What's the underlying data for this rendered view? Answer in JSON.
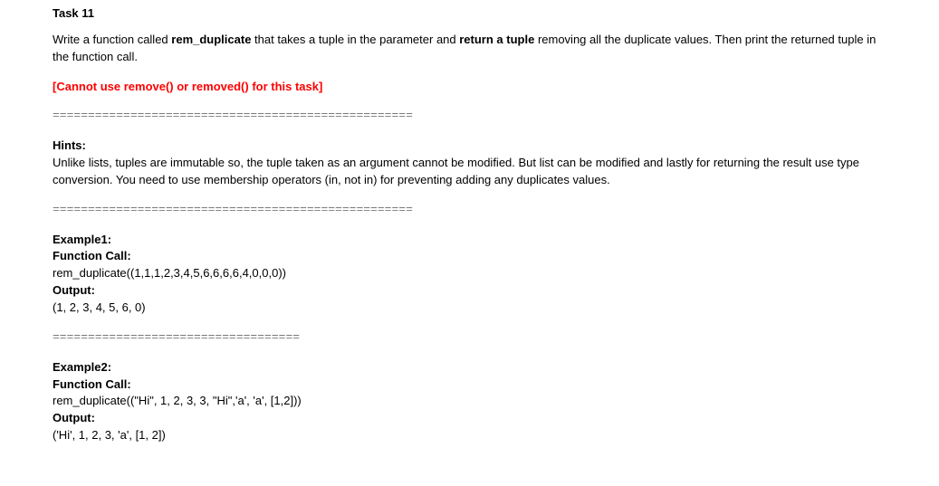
{
  "task": {
    "title": "Task 11",
    "intro_prefix": "Write a function called ",
    "func_name": "rem_duplicate",
    "intro_mid": " that takes a tuple in the parameter and ",
    "return_bold": "return a tuple",
    "intro_suffix": " removing all the duplicate values. Then print the returned tuple in the function call.",
    "restriction": "[Cannot use remove() or removed() for this task]",
    "divider_long": "===================================================",
    "hints_label": "Hints:",
    "hints_text": "Unlike lists, tuples are immutable so, the tuple taken as an argument cannot be modified. But list can be modified and lastly for returning the result use type conversion. You need to use membership operators (in, not in) for preventing adding any duplicates values.",
    "ex1": {
      "heading": "Example1:",
      "call_label": "Function Call:",
      "call": "rem_duplicate((1,1,1,2,3,4,5,6,6,6,6,4,0,0,0))",
      "output_label": "Output:",
      "output": "(1, 2, 3, 4, 5, 6, 0)"
    },
    "divider_short": "===================================",
    "ex2": {
      "heading": "Example2:",
      "call_label": "Function Call:",
      "call": "rem_duplicate((\"Hi\", 1, 2, 3, 3, \"Hi\",'a', 'a', [1,2]))",
      "output_label": "Output:",
      "output": "('Hi', 1, 2, 3, 'a', [1, 2])"
    }
  }
}
